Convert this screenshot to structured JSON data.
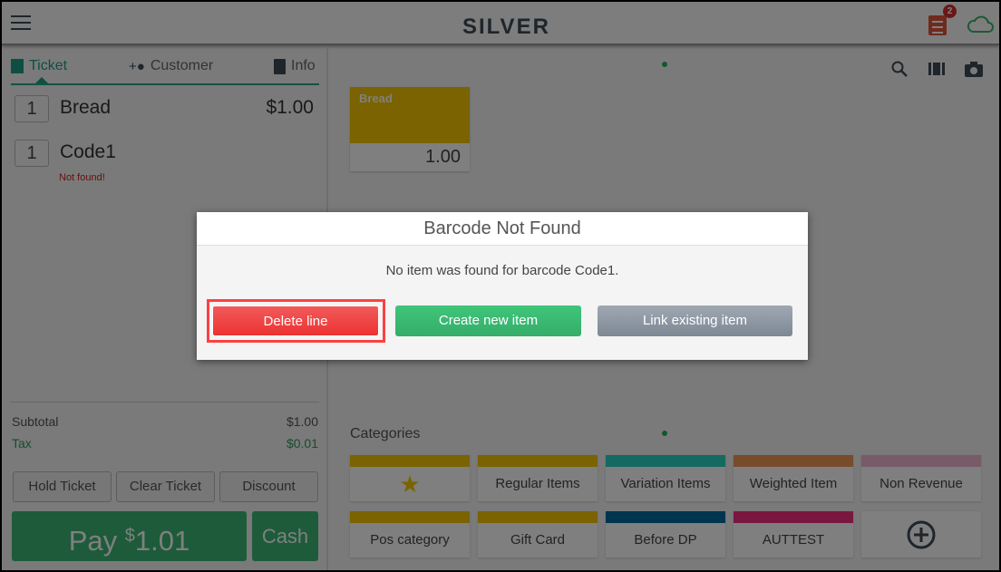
{
  "header": {
    "logo": "SILVER",
    "ticket_badge": "2"
  },
  "ticket_tabs": [
    {
      "label": "Ticket",
      "icon": "receipt-icon",
      "active": true
    },
    {
      "label": "Customer",
      "icon": "add-person-icon"
    },
    {
      "label": "Info",
      "icon": "document-add-icon"
    }
  ],
  "lines": [
    {
      "qty": "1",
      "name": "Bread",
      "price": "$1.00"
    },
    {
      "qty": "1",
      "name": "Code1",
      "price": "",
      "status": "Not found!"
    }
  ],
  "totals": {
    "subtotal_label": "Subtotal",
    "subtotal": "$1.00",
    "tax_label": "Tax",
    "tax": "$0.01"
  },
  "actions": {
    "hold": "Hold Ticket",
    "clear": "Clear Ticket",
    "discount": "Discount",
    "pay_label": "Pay",
    "pay_currency": "$",
    "pay_amount": "1.01",
    "cash": "Cash"
  },
  "toolbar_icons": [
    "search-icon",
    "barcode-icon",
    "camera-icon"
  ],
  "items": [
    {
      "name": "Bread",
      "price": "1.00",
      "color": "#f4c600"
    }
  ],
  "categories_label": "Categories",
  "categories": [
    {
      "label": "",
      "icon": "star-icon",
      "color": "#f4c600"
    },
    {
      "label": "Regular Items",
      "color": "#f4c600"
    },
    {
      "label": "Variation Items",
      "color": "#28d4c0"
    },
    {
      "label": "Weighted Item",
      "color": "#f09854"
    },
    {
      "label": "Non Revenue",
      "color": "#f0b4d0"
    },
    {
      "label": "Pos category",
      "color": "#f4c600"
    },
    {
      "label": "Gift Card",
      "color": "#f4c600"
    },
    {
      "label": "Before DP",
      "color": "#006aa0"
    },
    {
      "label": "AUTTEST",
      "color": "#f03080"
    },
    {
      "label": "",
      "icon": "add-circle-icon",
      "color": "#ffffff"
    }
  ],
  "dialog": {
    "title": "Barcode Not Found",
    "message": "No item was found for barcode Code1.",
    "delete": "Delete line",
    "create": "Create new item",
    "link": "Link existing item"
  }
}
